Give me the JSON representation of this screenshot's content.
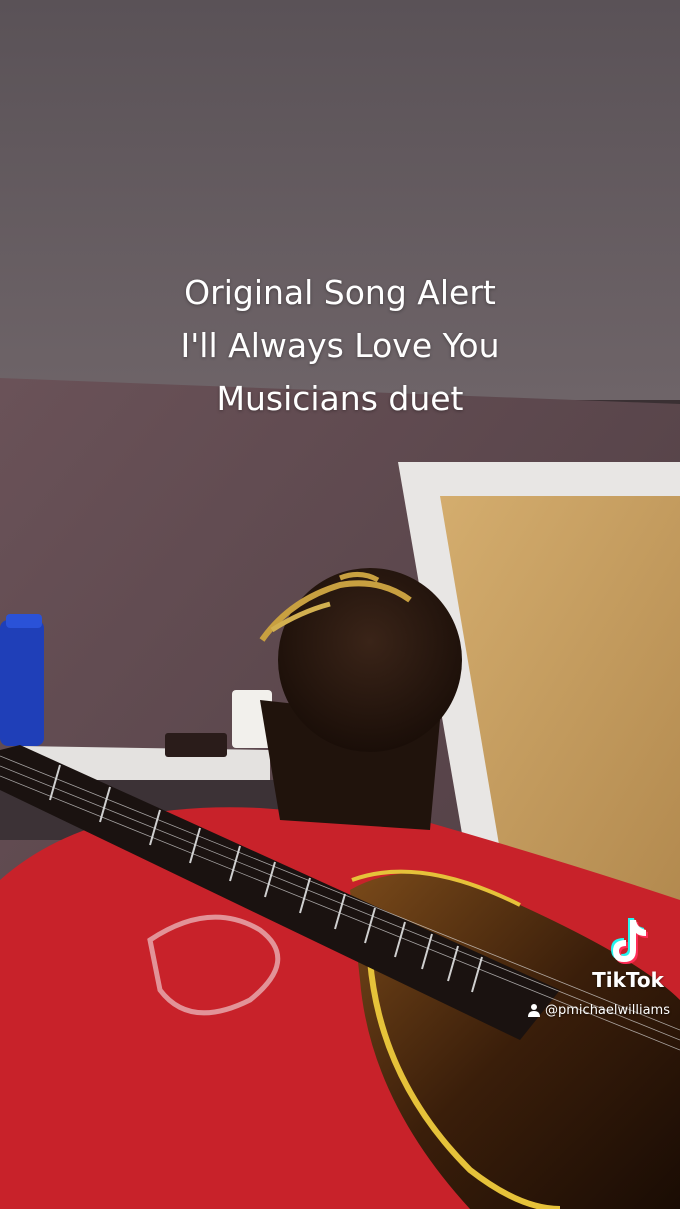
{
  "caption": {
    "line1": "Original Song Alert",
    "line2": "I'll Always Love You",
    "line3": "Musicians duet"
  },
  "watermark": {
    "brand": "TikTok",
    "handle": "@pmichaelwilliams",
    "logo_icon": "tiktok-note-icon",
    "user_icon": "user-icon"
  },
  "colors": {
    "caption_text": "#ffffff",
    "shirt_red": "#c8222a",
    "wall": "#5e4a4e",
    "ceiling": "#6a6066",
    "door": "#c9a264"
  }
}
